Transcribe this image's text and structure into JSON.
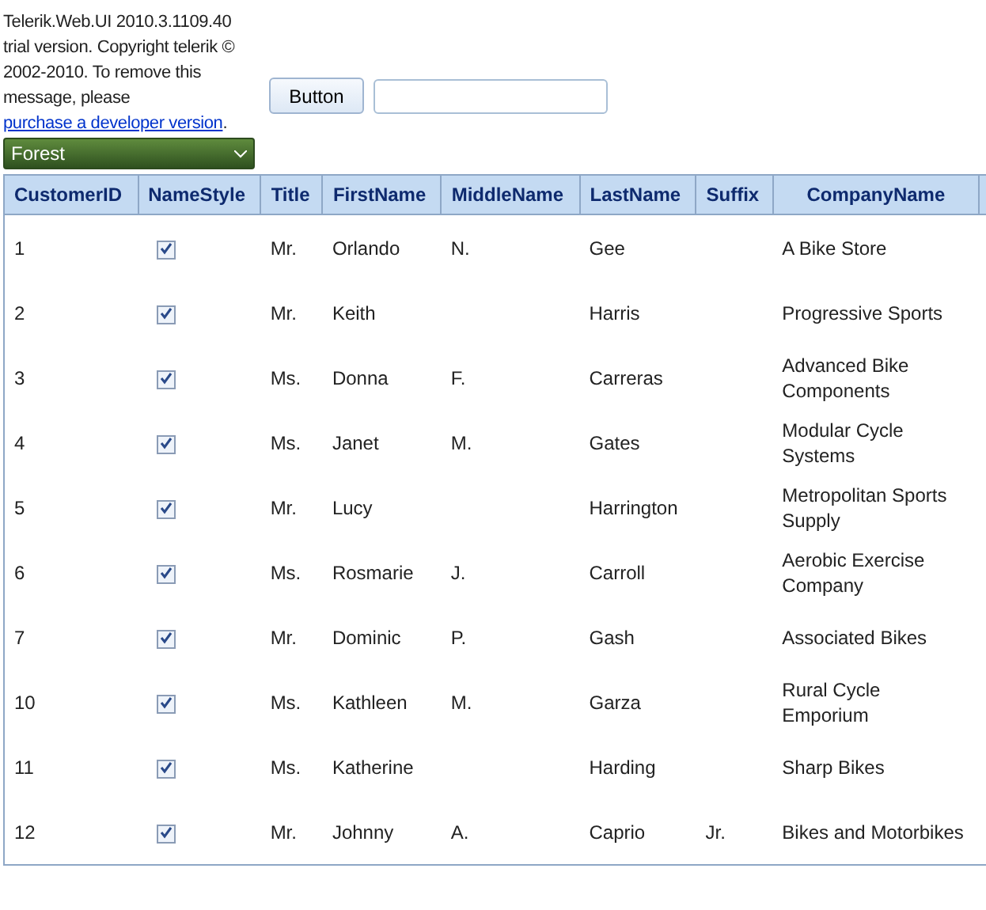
{
  "notice": {
    "text": "Telerik.Web.UI 2010.3.1109.40 trial version. Copyright telerik © 2002-2010. To remove this message, please ",
    "link": "purchase a developer version",
    "end": "."
  },
  "button": {
    "label": "Button"
  },
  "skin_select": {
    "value": "Forest"
  },
  "table": {
    "columns": [
      "CustomerID",
      "NameStyle",
      "Title",
      "FirstName",
      "MiddleName",
      "LastName",
      "Suffix",
      "CompanyName"
    ],
    "rows": [
      {
        "id": "1",
        "name_style": true,
        "title": "Mr.",
        "first": "Orlando",
        "middle": "N.",
        "last": "Gee",
        "suffix": "",
        "company": "A Bike Store"
      },
      {
        "id": "2",
        "name_style": true,
        "title": "Mr.",
        "first": "Keith",
        "middle": "",
        "last": "Harris",
        "suffix": "",
        "company": "Progressive Sports"
      },
      {
        "id": "3",
        "name_style": true,
        "title": "Ms.",
        "first": "Donna",
        "middle": "F.",
        "last": "Carreras",
        "suffix": "",
        "company": "Advanced Bike Components"
      },
      {
        "id": "4",
        "name_style": true,
        "title": "Ms.",
        "first": "Janet",
        "middle": "M.",
        "last": "Gates",
        "suffix": "",
        "company": "Modular Cycle Systems"
      },
      {
        "id": "5",
        "name_style": true,
        "title": "Mr.",
        "first": "Lucy",
        "middle": "",
        "last": "Harrington",
        "suffix": "",
        "company": "Metropolitan Sports Supply"
      },
      {
        "id": "6",
        "name_style": true,
        "title": "Ms.",
        "first": "Rosmarie",
        "middle": "J.",
        "last": "Carroll",
        "suffix": "",
        "company": "Aerobic Exercise Company"
      },
      {
        "id": "7",
        "name_style": true,
        "title": "Mr.",
        "first": "Dominic",
        "middle": "P.",
        "last": "Gash",
        "suffix": "",
        "company": "Associated Bikes"
      },
      {
        "id": "10",
        "name_style": true,
        "title": "Ms.",
        "first": "Kathleen",
        "middle": "M.",
        "last": "Garza",
        "suffix": "",
        "company": "Rural Cycle Emporium"
      },
      {
        "id": "11",
        "name_style": true,
        "title": "Ms.",
        "first": "Katherine",
        "middle": "",
        "last": "Harding",
        "suffix": "",
        "company": "Sharp Bikes"
      },
      {
        "id": "12",
        "name_style": true,
        "title": "Mr.",
        "first": "Johnny",
        "middle": "A.",
        "last": "Caprio",
        "suffix": "Jr.",
        "company": "Bikes and Motorbikes"
      }
    ]
  }
}
